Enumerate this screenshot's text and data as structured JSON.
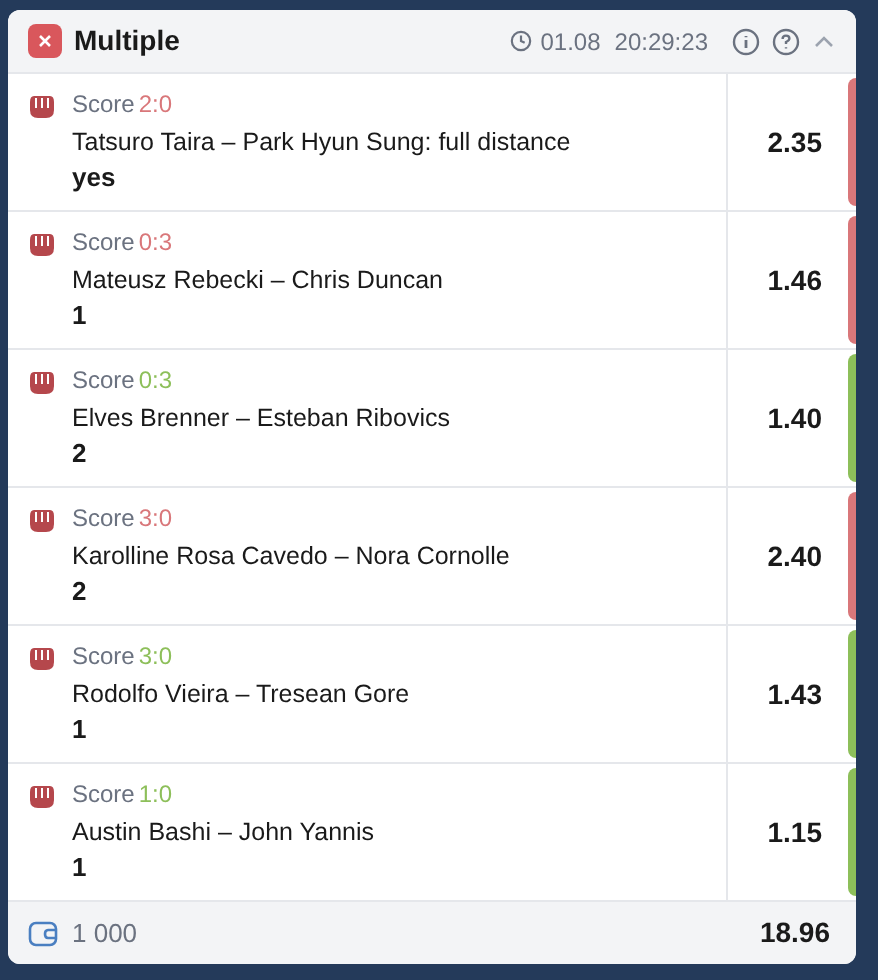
{
  "header": {
    "title": "Multiple",
    "date": "01.08",
    "time": "20:29:23"
  },
  "bets": [
    {
      "score_label": "Score",
      "score": "2:0",
      "color": "#d9777a",
      "event": "Tatsuro Taira – Park Hyun Sung: full distance",
      "pick": "yes",
      "odds": "2.35"
    },
    {
      "score_label": "Score",
      "score": "0:3",
      "color": "#d9777a",
      "event": "Mateusz Rebecki – Chris Duncan",
      "pick": "1",
      "odds": "1.46"
    },
    {
      "score_label": "Score",
      "score": "0:3",
      "color": "#8dbf5a",
      "event": "Elves Brenner – Esteban Ribovics",
      "pick": "2",
      "odds": "1.40"
    },
    {
      "score_label": "Score",
      "score": "3:0",
      "color": "#d9777a",
      "event": "Karolline Rosa Cavedo – Nora Cornolle",
      "pick": "2",
      "odds": "2.40"
    },
    {
      "score_label": "Score",
      "score": "3:0",
      "color": "#8dbf5a",
      "event": "Rodolfo Vieira – Tresean Gore",
      "pick": "1",
      "odds": "1.43"
    },
    {
      "score_label": "Score",
      "score": "1:0",
      "color": "#8dbf5a",
      "event": "Austin Bashi – John Yannis",
      "pick": "1",
      "odds": "1.15"
    }
  ],
  "footer": {
    "stake": "1 000",
    "total_odds": "18.96"
  }
}
